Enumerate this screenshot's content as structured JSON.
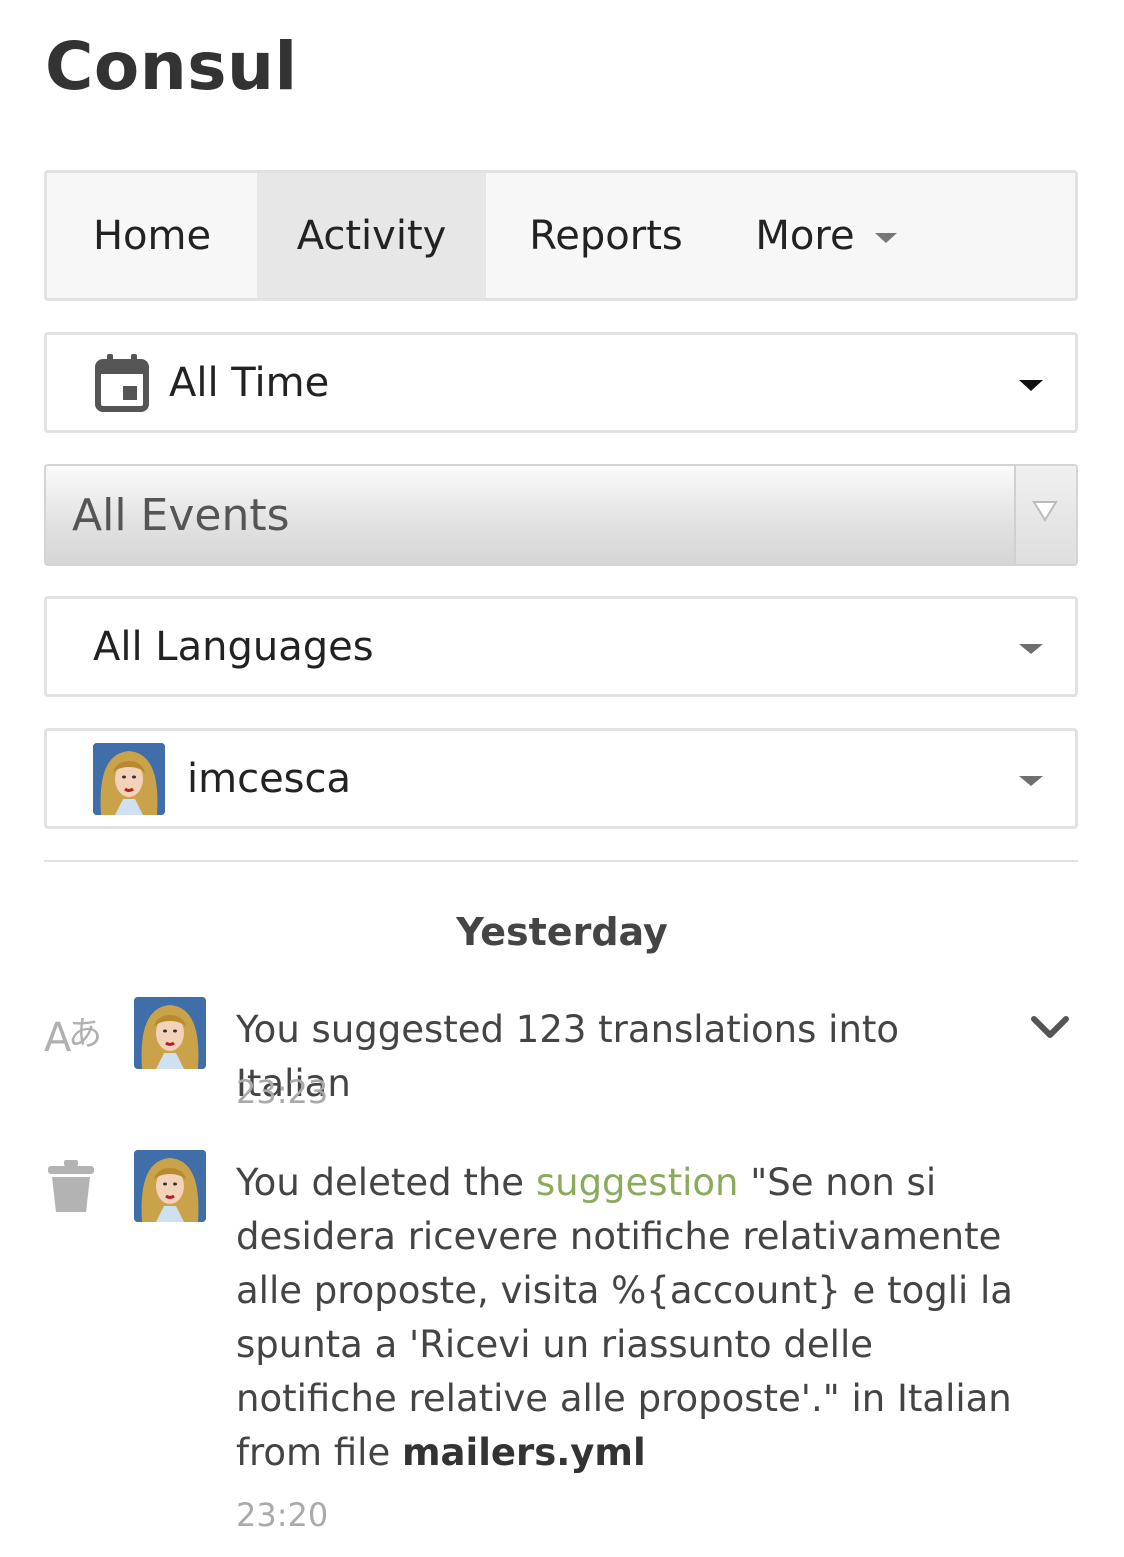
{
  "app": {
    "title": "Consul"
  },
  "tabs": [
    {
      "label": "Home",
      "active": false
    },
    {
      "label": "Activity",
      "active": true
    },
    {
      "label": "Reports",
      "active": false
    },
    {
      "label": "More",
      "active": false
    }
  ],
  "filters": {
    "time": {
      "label": "All Time",
      "icon": "calendar-icon"
    },
    "events": {
      "label": "All Events"
    },
    "languages": {
      "label": "All Languages"
    },
    "user": {
      "label": "imcesca",
      "icon": "avatar"
    }
  },
  "feed": {
    "day_heading": "Yesterday",
    "events": [
      {
        "icon": "translate-icon",
        "text": "You suggested 123 translations into Italian",
        "time": "23:23"
      },
      {
        "icon": "trash-icon",
        "text_before": "You deleted the ",
        "link": "suggestion",
        "text_after": " \"Se non si desidera ricevere notifiche relativamente alle proposte, visita %{account} e togli la spunta a 'Ricevi un riassunto delle notifiche relative alle proposte'.\" in Italian from file ",
        "file": "mailers.yml",
        "time": "23:20"
      }
    ]
  },
  "colors": {
    "link": "#8bab5c",
    "active_tab": "#e7e7e7",
    "muted": "#aaaaaa"
  }
}
